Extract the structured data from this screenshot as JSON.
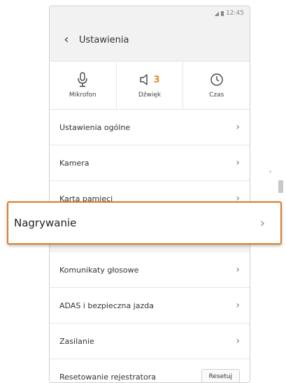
{
  "status": {
    "time": "12:45"
  },
  "header": {
    "title": "Ustawienia"
  },
  "tabs": [
    {
      "label": "Mikrofon",
      "icon": "microphone-icon"
    },
    {
      "label": "Dźwięk",
      "icon": "speaker-icon",
      "badge": "3"
    },
    {
      "label": "Czas",
      "icon": "clock-icon"
    }
  ],
  "items": [
    {
      "label": "Ustawienia ogólne"
    },
    {
      "label": "Kamera"
    },
    {
      "label": "Karta pamięci"
    },
    {
      "label": "Nagrywanie"
    },
    {
      "label": "Komunikaty głosowe"
    },
    {
      "label": "ADAS i bezpieczna jazda"
    },
    {
      "label": "Zasilanie"
    },
    {
      "label": "Resetowanie rejestratora",
      "button": "Resetuj"
    }
  ],
  "colors": {
    "highlight": "#e07a26",
    "badge": "#e38b2c"
  }
}
